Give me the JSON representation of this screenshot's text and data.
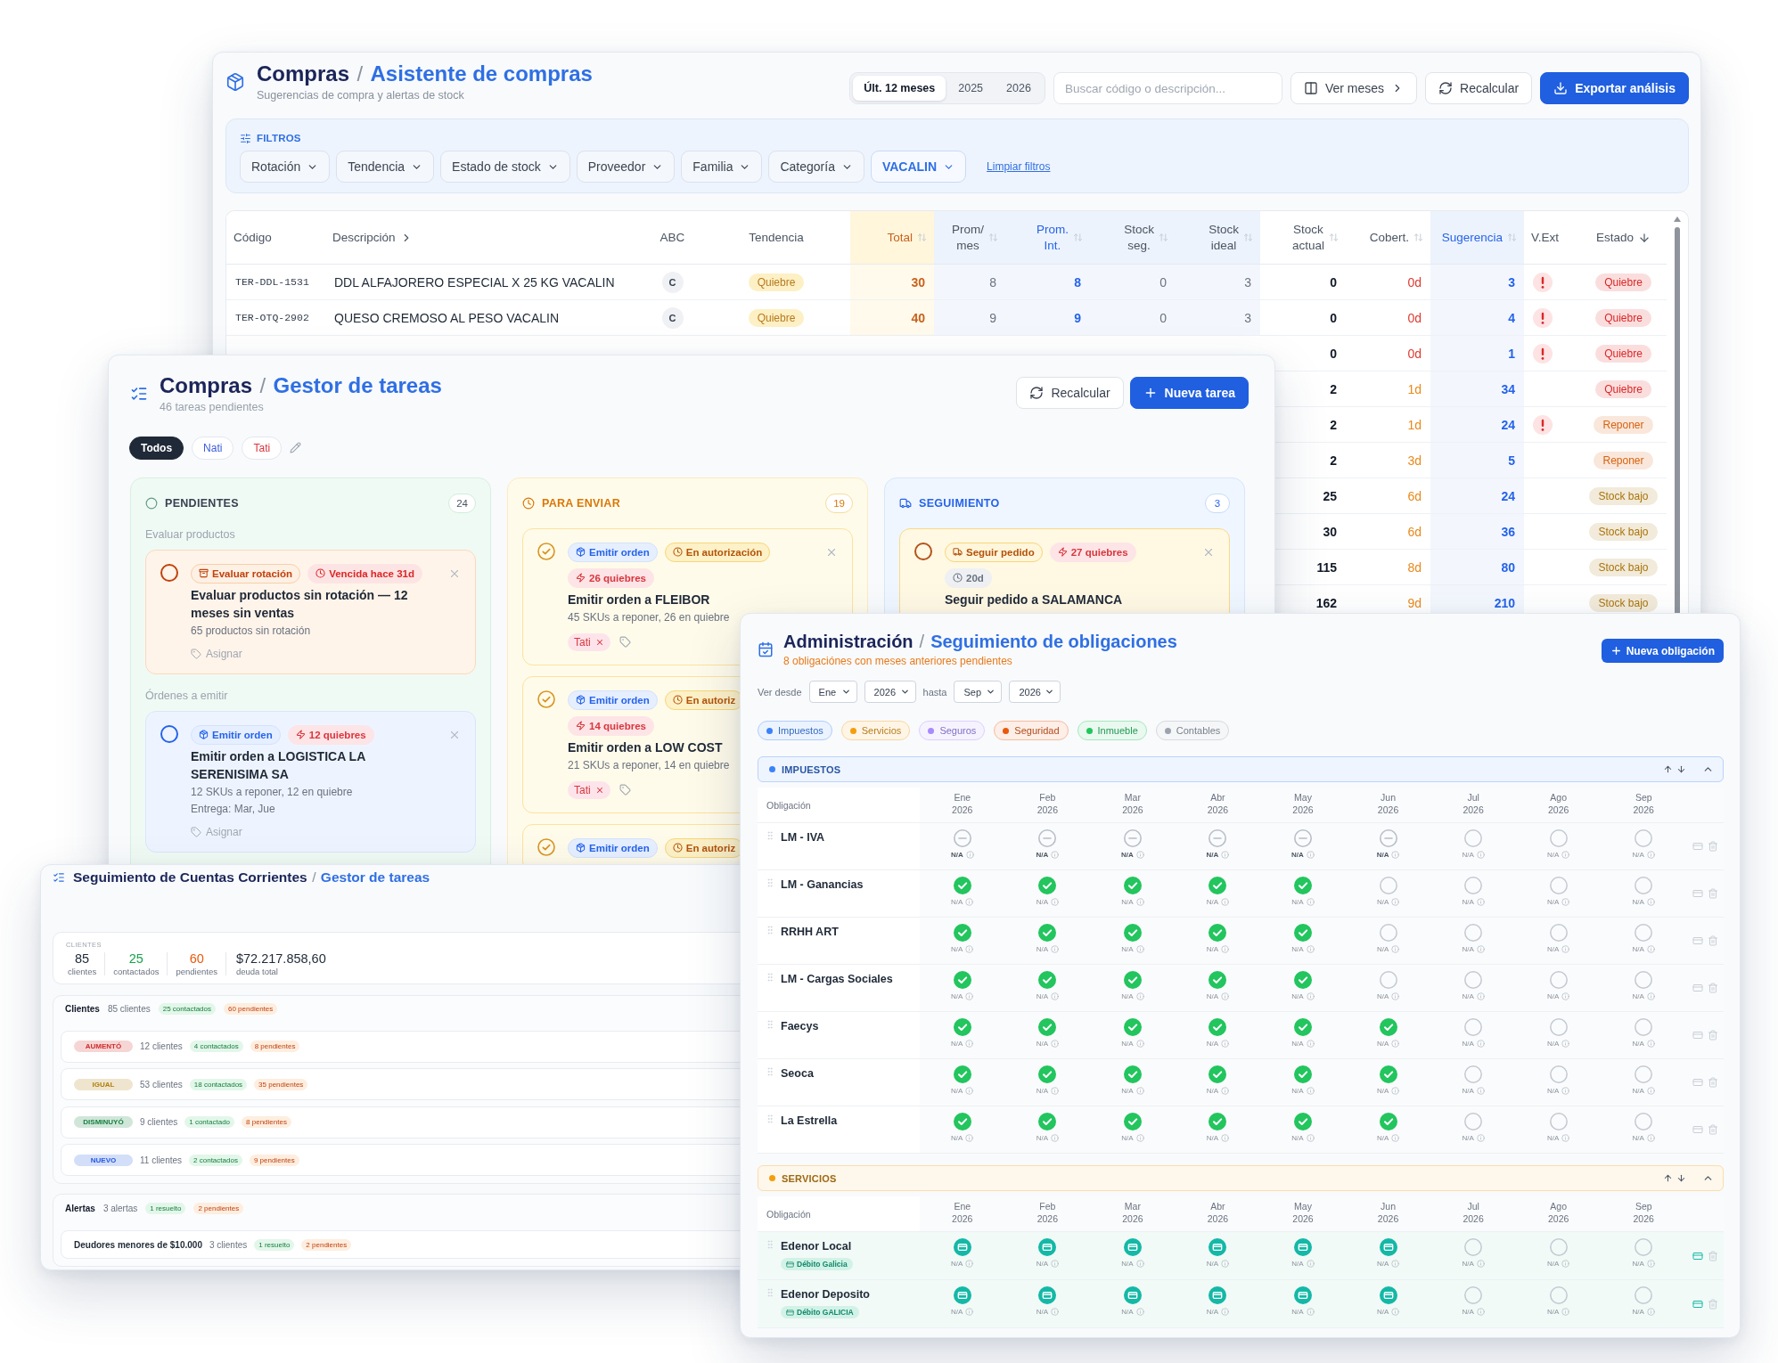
{
  "purchase_assistant": {
    "title": {
      "section": "Compras",
      "separator": "/",
      "page": "Asistente de compras"
    },
    "subtitle": "Sugerencias de compra y alertas de stock",
    "periods": [
      {
        "label": "Últ. 12 meses",
        "selected": true
      },
      {
        "label": "2025",
        "selected": false
      },
      {
        "label": "2026",
        "selected": false
      }
    ],
    "search": {
      "placeholder": "Buscar código o descripción..."
    },
    "actions": [
      {
        "label": "Ver meses",
        "kind": "months"
      },
      {
        "label": "Recalcular",
        "kind": "refresh"
      },
      {
        "label": "Exportar análisis",
        "kind": "export"
      }
    ],
    "filters": {
      "title": "FILTROS",
      "items": [
        {
          "label": "Rotación",
          "active": false
        },
        {
          "label": "Tendencia",
          "active": false
        },
        {
          "label": "Estado de stock",
          "active": false
        },
        {
          "label": "Proveedor",
          "active": false
        },
        {
          "label": "Familia",
          "active": false
        },
        {
          "label": "Categoría",
          "active": false
        },
        {
          "label": "VACALIN",
          "active": true
        }
      ],
      "clear": "Limpiar filtros"
    },
    "table": {
      "columns": [
        {
          "label": "Código",
          "kind": "code",
          "sortable": false,
          "expandable": false,
          "sorted": false
        },
        {
          "label": "Descripción",
          "kind": "text",
          "sortable": false,
          "expandable": true,
          "sorted": false
        },
        {
          "label": "ABC",
          "kind": "grade",
          "sortable": false,
          "expandable": false,
          "sorted": false
        },
        {
          "label": "Tendencia",
          "kind": "trend",
          "sortable": false,
          "expandable": false,
          "sorted": false
        },
        {
          "label": "Total",
          "kind": "total",
          "sortable": true,
          "expandable": false,
          "sorted": false
        },
        {
          "label": "Prom/ mes",
          "kind": "average",
          "sortable": true,
          "expandable": false,
          "sorted": false
        },
        {
          "label": "Prom. Int.",
          "kind": "highlight",
          "sortable": true,
          "expandable": false,
          "sorted": false
        },
        {
          "label": "Stock seg.",
          "kind": "average",
          "sortable": true,
          "expandable": false,
          "sorted": false
        },
        {
          "label": "Stock ideal",
          "kind": "average",
          "sortable": true,
          "expandable": false,
          "sorted": false
        },
        {
          "label": "Stock actual",
          "kind": "stock",
          "sortable": true,
          "expandable": false,
          "sorted": false
        },
        {
          "label": "Cobert.",
          "kind": "coverage",
          "sortable": true,
          "expandable": false,
          "sorted": false
        },
        {
          "label": "Sugerencia",
          "kind": "highlight",
          "sortable": true,
          "expandable": false,
          "sorted": false
        },
        {
          "label": "V.Ext",
          "kind": "alert",
          "sortable": false,
          "expandable": false,
          "sorted": false
        },
        {
          "label": "Estado",
          "kind": "status",
          "sortable": false,
          "expandable": false,
          "sorted": true
        }
      ],
      "rows": [
        {
          "cells": [
            "TER-DDL-1531",
            "DDL ALFAJORERO ESPECIAL X 25 KG VACALIN",
            "C",
            "Quiebre",
            "30",
            "8",
            "8",
            "0",
            "3",
            "0",
            {
              "text": "0d",
              "color": "#dc3b30"
            },
            "3",
            true,
            {
              "text": "Quiebre",
              "color": "#dc2626"
            }
          ]
        },
        {
          "cells": [
            "TER-OTQ-2902",
            "QUESO CREMOSO AL PESO VACALIN",
            "C",
            "Quiebre",
            "40",
            "9",
            "9",
            "0",
            "3",
            "0",
            {
              "text": "0d",
              "color": "#dc3b30"
            },
            "4",
            true,
            {
              "text": "Quiebre",
              "color": "#dc2626"
            }
          ]
        },
        {
          "cells": [
            "0",
            {
              "text": "0d",
              "color": "#dc3b30"
            },
            "1",
            true,
            {
              "text": "Quiebre",
              "color": "#dc2626"
            }
          ]
        },
        {
          "cells": [
            "2",
            {
              "text": "1d",
              "color": "#e8891a"
            },
            "34",
            false,
            {
              "text": "Quiebre",
              "color": "#dc2626"
            }
          ]
        },
        {
          "cells": [
            "2",
            {
              "text": "1d",
              "color": "#e8891a"
            },
            "24",
            true,
            {
              "text": "Reponer",
              "color": "#d9620f"
            }
          ]
        },
        {
          "cells": [
            "2",
            {
              "text": "3d",
              "color": "#e8891a"
            },
            "5",
            false,
            {
              "text": "Reponer",
              "color": "#d9620f"
            }
          ]
        },
        {
          "cells": [
            "25",
            {
              "text": "6d",
              "color": "#e8891a"
            },
            "24",
            false,
            {
              "text": "Stock bajo",
              "color": "#a8740a"
            }
          ]
        },
        {
          "cells": [
            "30",
            {
              "text": "6d",
              "color": "#e8891a"
            },
            "36",
            false,
            {
              "text": "Stock bajo",
              "color": "#a8740a"
            }
          ]
        },
        {
          "cells": [
            "115",
            {
              "text": "8d",
              "color": "#e8891a"
            },
            "80",
            false,
            {
              "text": "Stock bajo",
              "color": "#a8740a"
            }
          ]
        },
        {
          "cells": [
            "162",
            {
              "text": "9d",
              "color": "#e8891a"
            },
            "210",
            false,
            {
              "text": "Stock bajo",
              "color": "#a8740a"
            }
          ]
        }
      ]
    }
  },
  "task_manager": {
    "title": {
      "section": "Compras",
      "separator": "/",
      "page": "Gestor de tareas"
    },
    "subtitle": "46 tareas pendientes",
    "actions": [
      {
        "label": "Recalcular",
        "kind": "refresh"
      },
      {
        "label": "Nueva tarea",
        "kind": "add"
      }
    ],
    "people": [
      {
        "label": "Todos",
        "selected": true
      },
      {
        "label": "Nati",
        "selected": false,
        "color": "#3b5bdb"
      },
      {
        "label": "Tati",
        "selected": false,
        "color": "#d9363e"
      }
    ],
    "columns": [
      {
        "kind": "pending",
        "title": "PENDIENTES",
        "count": "24",
        "groups": [
          {
            "label": "Evaluar productos",
            "cards": [
              {
                "kind": "evaluate",
                "checked": false,
                "close": true,
                "tag_rows": [
                  [
                    {
                      "kind": "evaluate",
                      "text": "Evaluar rotación"
                    },
                    {
                      "kind": "overdue",
                      "text": "Vencida hace 31d"
                    }
                  ]
                ],
                "title": "Evaluar productos sin rotación — 12 meses sin ventas",
                "details": [
                  "65 productos sin rotación"
                ],
                "assign": "Asignar"
              }
            ]
          },
          {
            "label": "Órdenes a emitir",
            "cards": [
              {
                "kind": "order",
                "checked": false,
                "close": true,
                "tag_rows": [
                  [
                    {
                      "kind": "order",
                      "text": "Emitir orden"
                    },
                    {
                      "kind": "breaks",
                      "text": "12 quiebres"
                    }
                  ]
                ],
                "title": "Emitir orden a LOGISTICA LA SERENISIMA SA",
                "details": [
                  "12 SKUs a reponer, 12 en quiebre",
                  "Entrega: Mar, Jue"
                ],
                "assign": "Asignar"
              }
            ]
          }
        ]
      },
      {
        "kind": "to_send",
        "title": "PARA ENVIAR",
        "count": "19",
        "groups": [
          {
            "cards": [
              {
                "kind": "send",
                "checked": true,
                "close": true,
                "tag_rows": [
                  [
                    {
                      "kind": "order",
                      "text": "Emitir orden"
                    },
                    {
                      "kind": "auth",
                      "text": "En autorización"
                    }
                  ],
                  [
                    {
                      "kind": "breaks",
                      "text": "26 quiebres"
                    }
                  ]
                ],
                "title": "Emitir orden a FLEIBOR",
                "details": [
                  "45 SKUs a reponer, 26 en quiebre"
                ],
                "assignee": "Tati"
              },
              {
                "kind": "send",
                "checked": true,
                "close": false,
                "tag_rows": [
                  [
                    {
                      "kind": "order",
                      "text": "Emitir orden"
                    },
                    {
                      "kind": "auth",
                      "text": "En autoriz"
                    }
                  ],
                  [
                    {
                      "kind": "breaks",
                      "text": "14 quiebres"
                    }
                  ]
                ],
                "title": "Emitir orden a LOW COST",
                "details": [
                  "21 SKUs a reponer, 14 en quiebre"
                ],
                "assignee": "Tati"
              },
              {
                "kind": "send",
                "checked": true,
                "close": false,
                "tag_rows": [
                  [
                    {
                      "kind": "order",
                      "text": "Emitir orden"
                    },
                    {
                      "kind": "auth",
                      "text": "En autoriz"
                    }
                  ]
                ]
              }
            ]
          }
        ]
      },
      {
        "kind": "follow",
        "title": "SEGUIMIENTO",
        "count": "3",
        "groups": [
          {
            "cards": [
              {
                "kind": "follow",
                "checked": false,
                "close": true,
                "tag_rows": [
                  [
                    {
                      "kind": "follow",
                      "text": "Seguir pedido"
                    },
                    {
                      "kind": "breaks",
                      "text": "27 quiebres"
                    }
                  ],
                  [
                    {
                      "kind": "age",
                      "text": "20d"
                    }
                  ]
                ],
                "title": "Seguir pedido a SALAMANCA"
              }
            ]
          }
        ]
      }
    ]
  },
  "accounts": {
    "title": {
      "section": "Seguimiento de Cuentas Corrientes",
      "separator": "/",
      "page": "Gestor de tareas"
    },
    "summary": {
      "label": "CLIENTES",
      "stats": [
        {
          "value": "85",
          "caption": "clientes",
          "color": "#1f2937"
        },
        {
          "value": "25",
          "caption": "contactados",
          "color": "#16a34a"
        },
        {
          "value": "60",
          "caption": "pendientes",
          "color": "#ea580c"
        },
        {
          "value": "$72.217.858,60",
          "caption": "deuda total",
          "color": "#1f2937"
        }
      ]
    },
    "clients": {
      "title": "Clientes",
      "count": "85 clientes",
      "contacted": "25 contactados",
      "pending": "60 pendientes",
      "groups": [
        {
          "label": "AUMENTÓ",
          "color": "#d12c2c",
          "count": "12 clientes",
          "contacted": "4 contactados",
          "pending": "8 pendientes"
        },
        {
          "label": "IGUAL",
          "color": "#b07d0a",
          "count": "53 clientes",
          "contacted": "18 contactados",
          "pending": "35 pendientes"
        },
        {
          "label": "DISMINUYÓ",
          "color": "#16803f",
          "count": "9 clientes",
          "contacted": "1 contactado",
          "pending": "8 pendientes"
        },
        {
          "label": "NUEVO",
          "color": "#2458e0",
          "count": "11 clientes",
          "contacted": "2 contactados",
          "pending": "9 pendientes"
        }
      ]
    },
    "alerts": {
      "title": "Alertas",
      "count": "3 alertas",
      "resolved": "1 resuelto",
      "pending": "2 pendientes",
      "items": [
        {
          "label": "Deudores menores de $10.000",
          "count": "3 clientes",
          "resolved": "1 resuelto",
          "pending": "2 pendientes"
        }
      ]
    }
  },
  "obligations": {
    "title": {
      "section": "Administración",
      "separator": "/",
      "page": "Seguimiento de obligaciones"
    },
    "subtitle": "8 obligaciónes con meses anteriores pendientes",
    "add_button": "Nueva obligación",
    "range": {
      "from_label": "Ver desde",
      "from_month": "Ene",
      "from_year": "2026",
      "to_label": "hasta",
      "to_month": "Sep",
      "to_year": "2026"
    },
    "categories": [
      {
        "label": "Impuestos",
        "color": "#3b82f6"
      },
      {
        "label": "Servicios",
        "color": "#f59e0b"
      },
      {
        "label": "Seguros",
        "color": "#a78bfa"
      },
      {
        "label": "Seguridad",
        "color": "#ea580c"
      },
      {
        "label": "Inmueble",
        "color": "#22c55e"
      },
      {
        "label": "Contables",
        "color": "#9ca3af"
      }
    ],
    "sections": [
      {
        "title": "IMPUESTOS",
        "color": "#3b82f6",
        "column_label": "Obligación",
        "months": [
          "Ene 2026",
          "Feb 2026",
          "Mar 2026",
          "Abr 2026",
          "May 2026",
          "Jun 2026",
          "Jul 2026",
          "Ago 2026",
          "Sep 2026"
        ],
        "rows": [
          {
            "name": "LM - IVA",
            "cells": [
              {
                "kind": "na",
                "note": "N/A"
              },
              {
                "kind": "na",
                "note": "N/A"
              },
              {
                "kind": "na",
                "note": "N/A"
              },
              {
                "kind": "na",
                "note": "N/A"
              },
              {
                "kind": "na",
                "note": "N/A"
              },
              {
                "kind": "na",
                "note": "N/A"
              },
              {
                "kind": "open",
                "note": "N/A"
              },
              {
                "kind": "open",
                "note": "N/A"
              },
              {
                "kind": "open",
                "note": "N/A"
              }
            ]
          },
          {
            "name": "LM - Ganancias",
            "cells": [
              {
                "kind": "done",
                "note": "N/A"
              },
              {
                "kind": "done",
                "note": "N/A"
              },
              {
                "kind": "done",
                "note": "N/A"
              },
              {
                "kind": "done",
                "note": "N/A"
              },
              {
                "kind": "done",
                "note": "N/A"
              },
              {
                "kind": "open",
                "note": "N/A"
              },
              {
                "kind": "open",
                "note": "N/A"
              },
              {
                "kind": "open",
                "note": "N/A"
              },
              {
                "kind": "open",
                "note": "N/A"
              }
            ]
          },
          {
            "name": "RRHH ART",
            "cells": [
              {
                "kind": "done",
                "note": "N/A"
              },
              {
                "kind": "done",
                "note": "N/A"
              },
              {
                "kind": "done",
                "note": "N/A"
              },
              {
                "kind": "done",
                "note": "N/A"
              },
              {
                "kind": "done",
                "note": "N/A"
              },
              {
                "kind": "open",
                "note": "N/A"
              },
              {
                "kind": "open",
                "note": "N/A"
              },
              {
                "kind": "open",
                "note": "N/A"
              },
              {
                "kind": "open",
                "note": "N/A"
              }
            ]
          },
          {
            "name": "LM - Cargas Sociales",
            "cells": [
              {
                "kind": "done",
                "note": "N/A"
              },
              {
                "kind": "done",
                "note": "N/A"
              },
              {
                "kind": "done",
                "note": "N/A"
              },
              {
                "kind": "done",
                "note": "N/A"
              },
              {
                "kind": "done",
                "note": "N/A"
              },
              {
                "kind": "open",
                "note": "N/A"
              },
              {
                "kind": "open",
                "note": "N/A"
              },
              {
                "kind": "open",
                "note": "N/A"
              },
              {
                "kind": "open",
                "note": "N/A"
              }
            ]
          },
          {
            "name": "Faecys",
            "cells": [
              {
                "kind": "done",
                "note": "N/A"
              },
              {
                "kind": "done",
                "note": "N/A"
              },
              {
                "kind": "done",
                "note": "N/A"
              },
              {
                "kind": "done",
                "note": "N/A"
              },
              {
                "kind": "done",
                "note": "N/A"
              },
              {
                "kind": "done",
                "note": "N/A"
              },
              {
                "kind": "open",
                "note": "N/A"
              },
              {
                "kind": "open",
                "note": "N/A"
              },
              {
                "kind": "open",
                "note": "N/A"
              }
            ]
          },
          {
            "name": "Seoca",
            "cells": [
              {
                "kind": "done",
                "note": "N/A"
              },
              {
                "kind": "done",
                "note": "N/A"
              },
              {
                "kind": "done",
                "note": "N/A"
              },
              {
                "kind": "done",
                "note": "N/A"
              },
              {
                "kind": "done",
                "note": "N/A"
              },
              {
                "kind": "done",
                "note": "N/A"
              },
              {
                "kind": "open",
                "note": "N/A"
              },
              {
                "kind": "open",
                "note": "N/A"
              },
              {
                "kind": "open",
                "note": "N/A"
              }
            ]
          },
          {
            "name": "La Estrella",
            "cells": [
              {
                "kind": "done",
                "note": "N/A"
              },
              {
                "kind": "done",
                "note": "N/A"
              },
              {
                "kind": "done",
                "note": "N/A"
              },
              {
                "kind": "done",
                "note": "N/A"
              },
              {
                "kind": "done",
                "note": "N/A"
              },
              {
                "kind": "done",
                "note": "N/A"
              },
              {
                "kind": "open",
                "note": "N/A"
              },
              {
                "kind": "open",
                "note": "N/A"
              },
              {
                "kind": "open",
                "note": "N/A"
              }
            ]
          }
        ]
      },
      {
        "title": "SERVICIOS",
        "color": "#f59e0b",
        "column_label": "Obligación",
        "months": [
          "Ene 2026",
          "Feb 2026",
          "Mar 2026",
          "Abr 2026",
          "May 2026",
          "Jun 2026",
          "Jul 2026",
          "Ago 2026",
          "Sep 2026"
        ],
        "rows": [
          {
            "name": "Edenor Local",
            "tag": "Débito Galicia",
            "cells": [
              {
                "kind": "debit",
                "note": "N/A"
              },
              {
                "kind": "debit",
                "note": "N/A"
              },
              {
                "kind": "debit",
                "note": "N/A"
              },
              {
                "kind": "debit",
                "note": "N/A"
              },
              {
                "kind": "debit",
                "note": "N/A"
              },
              {
                "kind": "debit",
                "note": "N/A"
              },
              {
                "kind": "open",
                "note": "N/A"
              },
              {
                "kind": "open",
                "note": "N/A"
              },
              {
                "kind": "open",
                "note": "N/A"
              }
            ]
          },
          {
            "name": "Edenor Deposito",
            "tag": "Débito GALICIA",
            "cells": [
              {
                "kind": "debit",
                "note": "N/A"
              },
              {
                "kind": "debit",
                "note": "N/A"
              },
              {
                "kind": "debit",
                "note": "N/A"
              },
              {
                "kind": "debit",
                "note": "N/A"
              },
              {
                "kind": "debit",
                "note": "N/A"
              },
              {
                "kind": "debit",
                "note": "N/A"
              },
              {
                "kind": "open",
                "note": "N/A"
              },
              {
                "kind": "open",
                "note": "N/A"
              },
              {
                "kind": "open",
                "note": "N/A"
              }
            ]
          }
        ]
      }
    ]
  }
}
